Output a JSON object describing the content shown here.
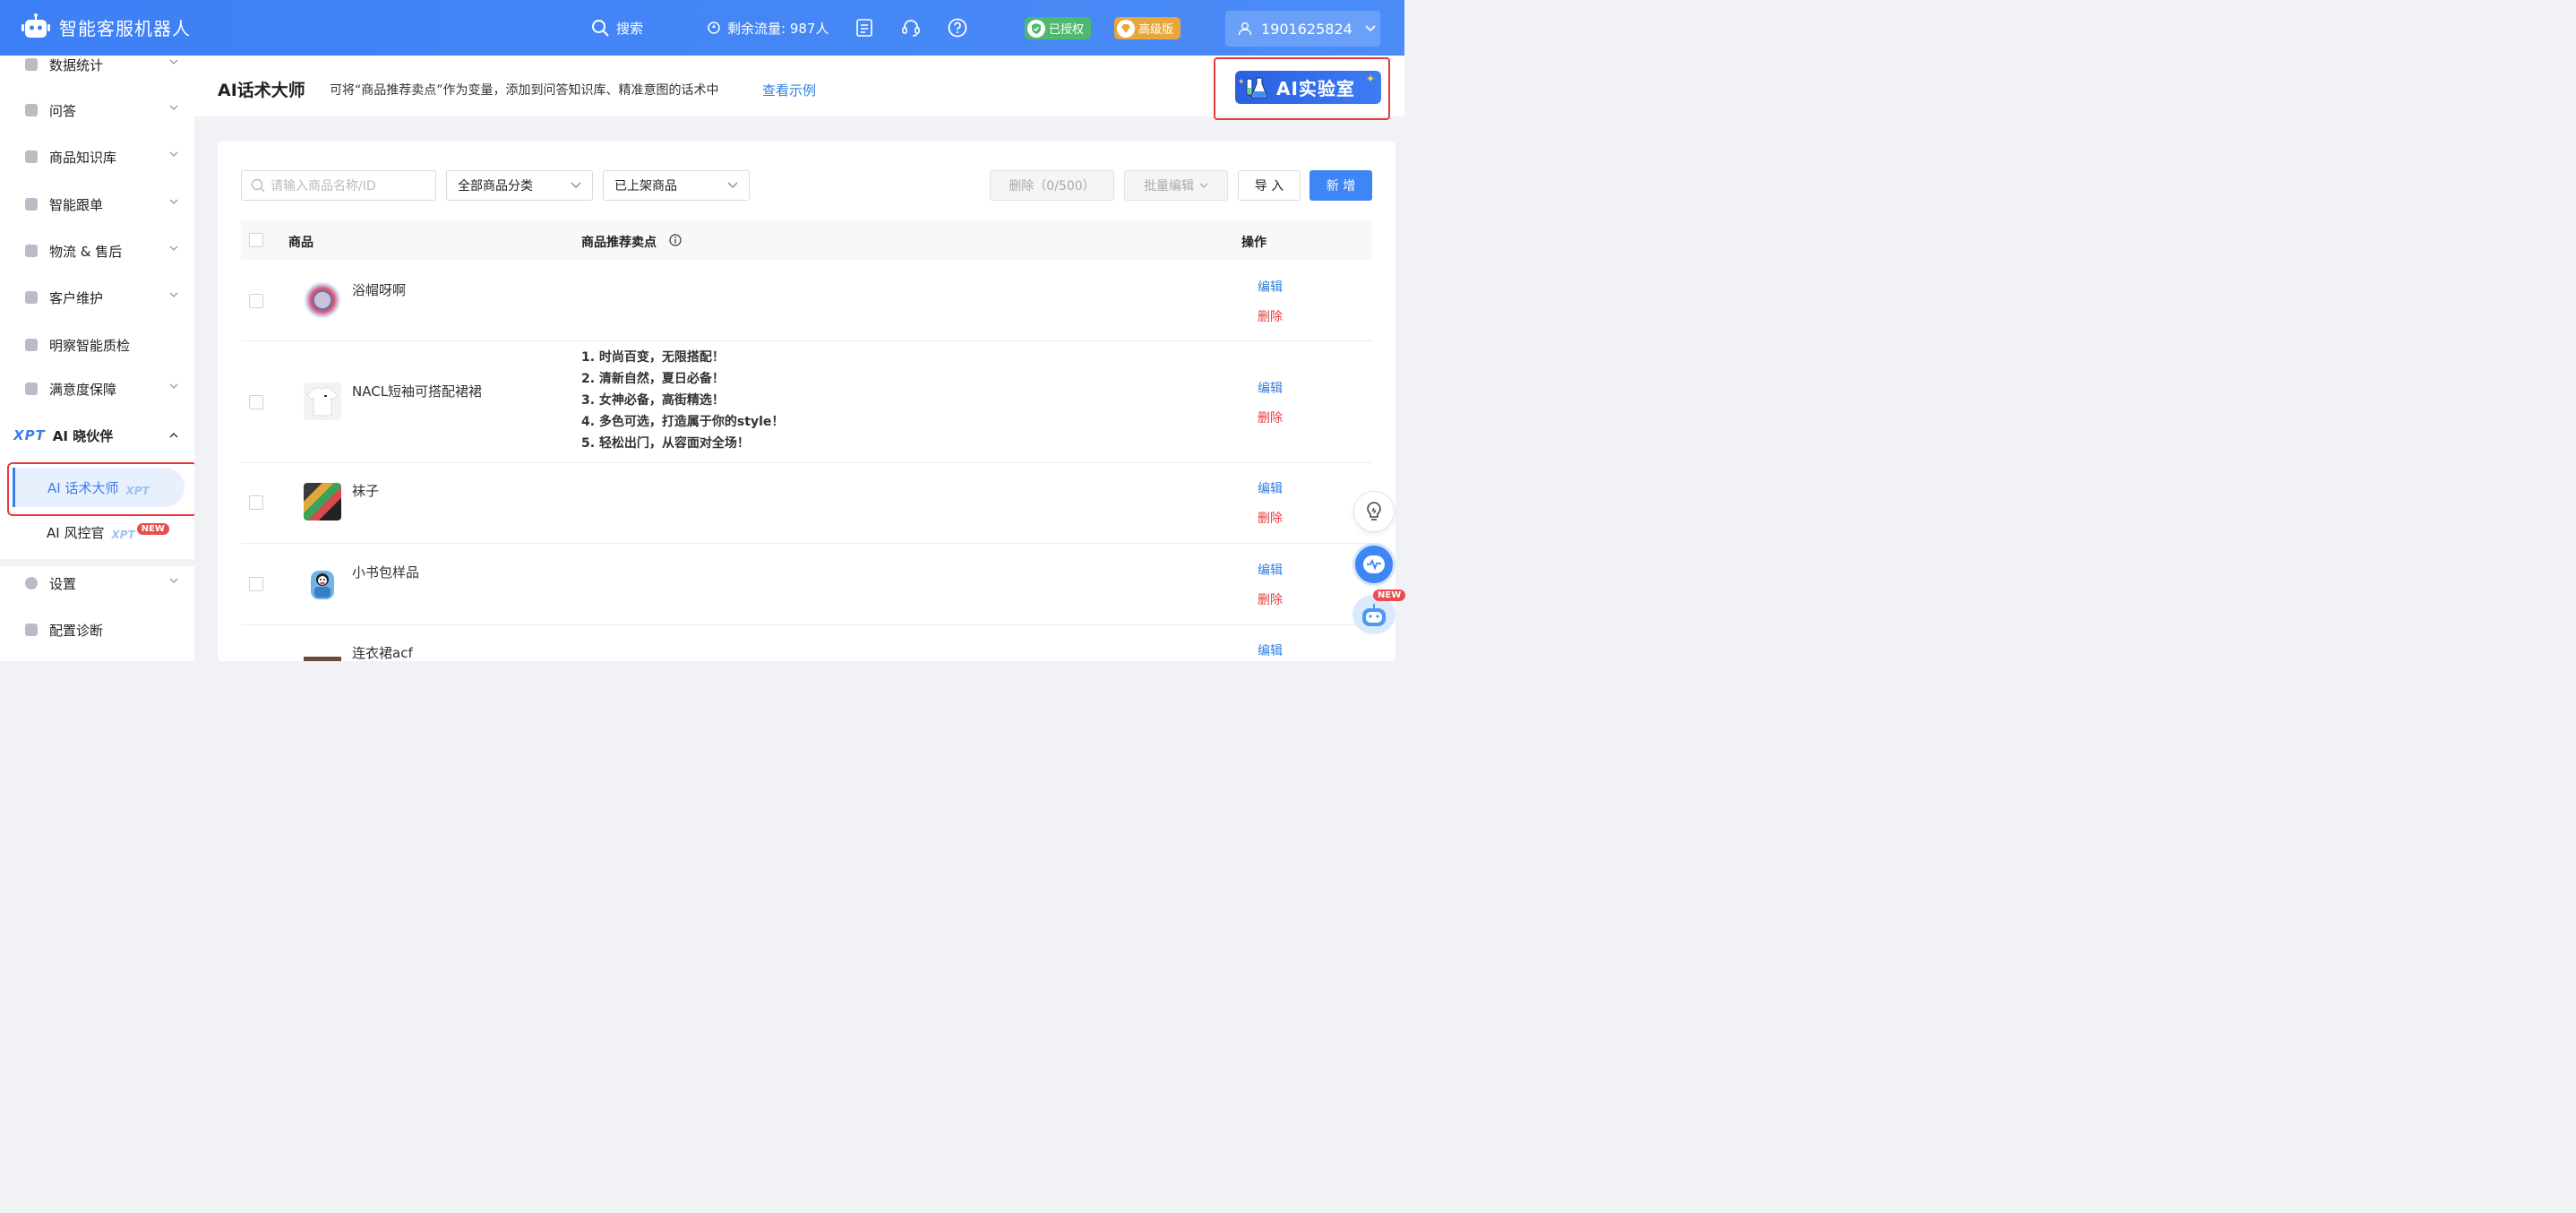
{
  "header": {
    "app_name": "智能客服机器人",
    "search_label": "搜索",
    "traffic_label": "剩余流量: 987人",
    "authorized_label": "已授权",
    "edition_label": "高级版",
    "user_id": "1901625824"
  },
  "sidebar": {
    "items": [
      {
        "label": "数据统计"
      },
      {
        "label": "问答"
      },
      {
        "label": "商品知识库"
      },
      {
        "label": "智能跟单"
      },
      {
        "label": "物流 & 售后"
      },
      {
        "label": "客户维护"
      },
      {
        "label": "明察智能质检"
      },
      {
        "label": "满意度保障"
      }
    ],
    "ai_group": {
      "prefix": "XPT",
      "label": "AI 晓伙伴"
    },
    "sub_items": [
      {
        "label": "AI 话术大师",
        "tag": "XPT"
      },
      {
        "label": "AI 风控官",
        "tag": "XPT",
        "badge": "NEW"
      }
    ],
    "bottom_items": [
      {
        "label": "设置"
      },
      {
        "label": "配置诊断"
      }
    ]
  },
  "page": {
    "title": "AI话术大师",
    "description": "可将“商品推荐卖点”作为变量，添加到问答知识库、精准意图的话术中",
    "example_link": "查看示例",
    "ai_lab_label": "AI实验室"
  },
  "toolbar": {
    "search_placeholder": "请输入商品名称/ID",
    "category_select": "全部商品分类",
    "status_select": "已上架商品",
    "delete_button": "删除（0/500）",
    "batch_edit_button": "批量编辑",
    "import_button": "导 入",
    "add_button": "新 增"
  },
  "table": {
    "columns": {
      "product": "商品",
      "selling_points": "商品推荐卖点",
      "actions": "操作"
    },
    "edit_label": "编辑",
    "delete_label": "删除",
    "rows": [
      {
        "name": "浴帽呀啊",
        "points": []
      },
      {
        "name": "NACL短袖可搭配裙裙",
        "points": [
          "1. 时尚百变，无限搭配！",
          "2. 清新自然，夏日必备！",
          "3. 女神必备，高街精选！",
          "4. 多色可选，打造属于你的style！",
          "5. 轻松出门，从容面对全场！"
        ]
      },
      {
        "name": "袜子",
        "points": []
      },
      {
        "name": "小书包样品",
        "points": []
      },
      {
        "name": "连衣裙acf",
        "points": []
      }
    ]
  },
  "floating": {
    "new_badge": "NEW"
  },
  "colors": {
    "primary": "#3e86f3",
    "danger": "#e43d3d",
    "header": "#4b8cf7"
  }
}
